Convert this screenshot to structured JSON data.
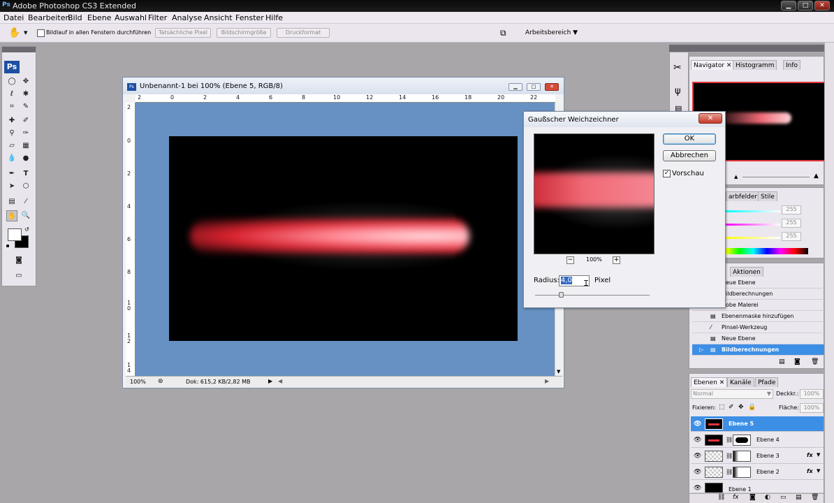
{
  "app": {
    "title": "Adobe Photoshop CS3 Extended",
    "logo": "Ps"
  },
  "menu": [
    "Datei",
    "Bearbeiten",
    "Bild",
    "Ebene",
    "Auswahl",
    "Filter",
    "Analyse",
    "Ansicht",
    "Fenster",
    "Hilfe"
  ],
  "options_bar": {
    "checkbox_label": "Bildlauf in allen Fenstern durchführen",
    "btn_actual": "Tatsächliche Pixel",
    "btn_screen": "Bildschirmgröße",
    "btn_print": "Druckformat",
    "workspace": "Arbeitsbereich ▼"
  },
  "document": {
    "title": "Unbenannt-1 bei 100% (Ebene 5, RGB/8)",
    "zoom": "100%",
    "doc_info": "Dok: 615,2 KB/2,82 MB",
    "ruler_h": [
      "2",
      "0",
      "2",
      "4",
      "6",
      "8",
      "10",
      "12",
      "14",
      "16",
      "18",
      "20",
      "22"
    ],
    "ruler_v": [
      "2",
      "0",
      "2",
      "4",
      "6",
      "8",
      "1 0",
      "1 2",
      "1 4"
    ]
  },
  "dialog": {
    "title": "Gaußscher Weichzeichner",
    "ok": "OK",
    "cancel": "Abbrechen",
    "preview_label": "Vorschau",
    "preview_checked": "✓",
    "zoom": "100%",
    "zoom_minus": "−",
    "zoom_plus": "+",
    "radius_label": "Radius:",
    "radius_value": "4,0",
    "radius_unit": "Pixel"
  },
  "navigator": {
    "tabs": [
      "Navigator",
      "Histogramm",
      "Info"
    ]
  },
  "color_panel": {
    "tabs": [
      "arbfelder",
      "Stile"
    ],
    "values": [
      "255",
      "255",
      "255"
    ]
  },
  "history": {
    "tabs": [
      "Aktionen"
    ],
    "items": [
      "eue Ebene",
      "ildberechnungen",
      "obe Malerei",
      "Ebenenmaske hinzufügen",
      "Pinsel-Werkzeug",
      "Neue Ebene",
      "Bildberechnungen"
    ]
  },
  "layers": {
    "tabs": [
      "Ebenen",
      "Kanäle",
      "Pfade"
    ],
    "blend_mode": "Normal",
    "opacity_label": "Deckkr.:",
    "opacity_value": "100%",
    "lock_label": "Fixieren:",
    "fill_label": "Fläche:",
    "fill_value": "100%",
    "fx": "fx",
    "rows": [
      "Ebene 5",
      "Ebene 4",
      "Ebene 3",
      "Ebene 2",
      "Ebene 1"
    ]
  }
}
